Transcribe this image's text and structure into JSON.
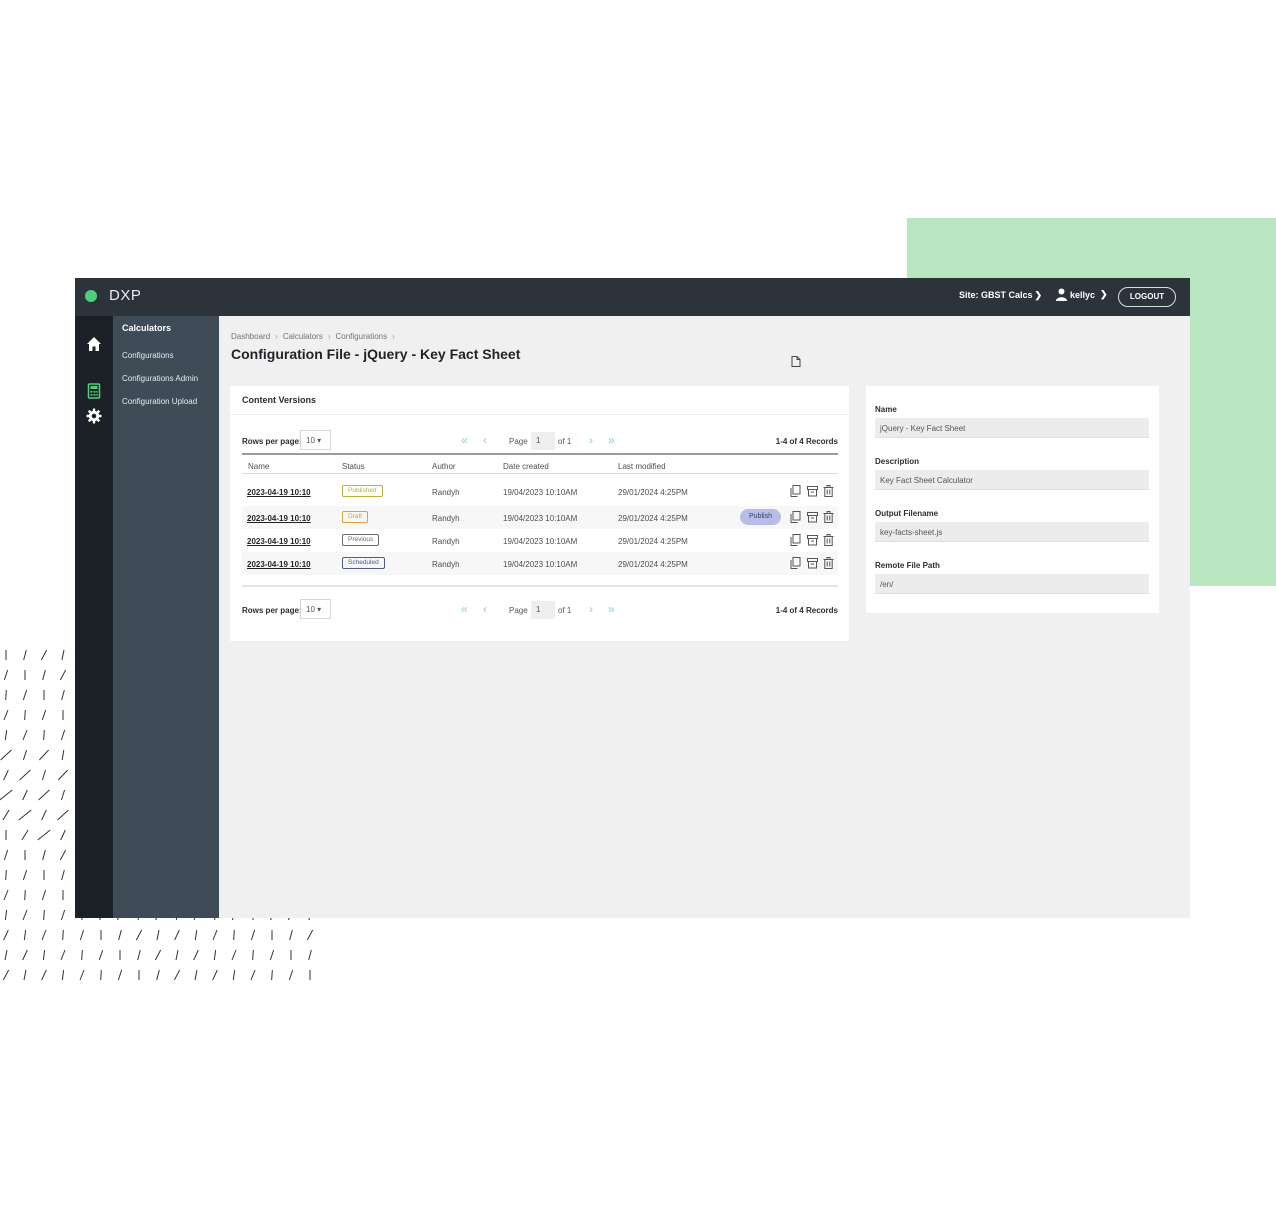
{
  "app": {
    "logo_text": "DXP",
    "logo_color": "#4cd07a",
    "site_selector": "Site: GBST Calcs",
    "username": "kellyc",
    "logout_label": "LOGOUT"
  },
  "iconbar": [
    {
      "icon": "home-icon"
    },
    {
      "icon": "calculator-icon",
      "active": true,
      "color": "#4cd07a"
    },
    {
      "icon": "gear-icon"
    }
  ],
  "subnav": {
    "title": "Calculators",
    "items": [
      "Configurations",
      "Configurations Admin",
      "Configuration Upload"
    ]
  },
  "breadcrumb": [
    "Dashboard",
    "Calculators",
    "Configurations"
  ],
  "page_title": "Configuration File - jQuery - Key Fact Sheet",
  "versions": {
    "title": "Content Versions",
    "rows_per_page_label": "Rows per page:",
    "rows_per_page": "10",
    "page_label": "Page",
    "page": "1",
    "of_label": "of 1",
    "records": "1-4 of 4 Records",
    "columns": [
      "Name",
      "Status",
      "Author",
      "Date created",
      "Last modified"
    ],
    "rows": [
      {
        "name": "2023-04-19 10:10",
        "status": "Published",
        "status_color": "#b8b23a",
        "author": "Randyh",
        "created": "19/04/2023 10:10AM",
        "modified": "29/01/2024 4:25PM",
        "publish_label": ""
      },
      {
        "name": "2023-04-19 10:10",
        "status": "Draft",
        "status_color": "#d9a23a",
        "author": "Randyh",
        "created": "19/04/2023 10:10AM",
        "modified": "29/01/2024 4:25PM",
        "publish_label": "Publish"
      },
      {
        "name": "2023-04-19 10:10",
        "status": "Previous",
        "status_color": "#6a6a6a",
        "author": "Randyh",
        "created": "19/04/2023 10:10AM",
        "modified": "29/01/2024 4:25PM",
        "publish_label": ""
      },
      {
        "name": "2023-04-19 10:10",
        "status": "Scheduled",
        "status_color": "#4d5a8a",
        "author": "Randyh",
        "created": "19/04/2023 10:10AM",
        "modified": "29/01/2024 4:25PM",
        "publish_label": ""
      }
    ]
  },
  "details": {
    "name_label": "Name",
    "name_value": "jQuery - Key Fact Sheet",
    "description_label": "Description",
    "description_value": "Key Fact Sheet Calculator",
    "output_label": "Output Filename",
    "output_value": "key-facts-sheet.js",
    "path_label": "Remote File Path",
    "path_value": "/en/"
  }
}
